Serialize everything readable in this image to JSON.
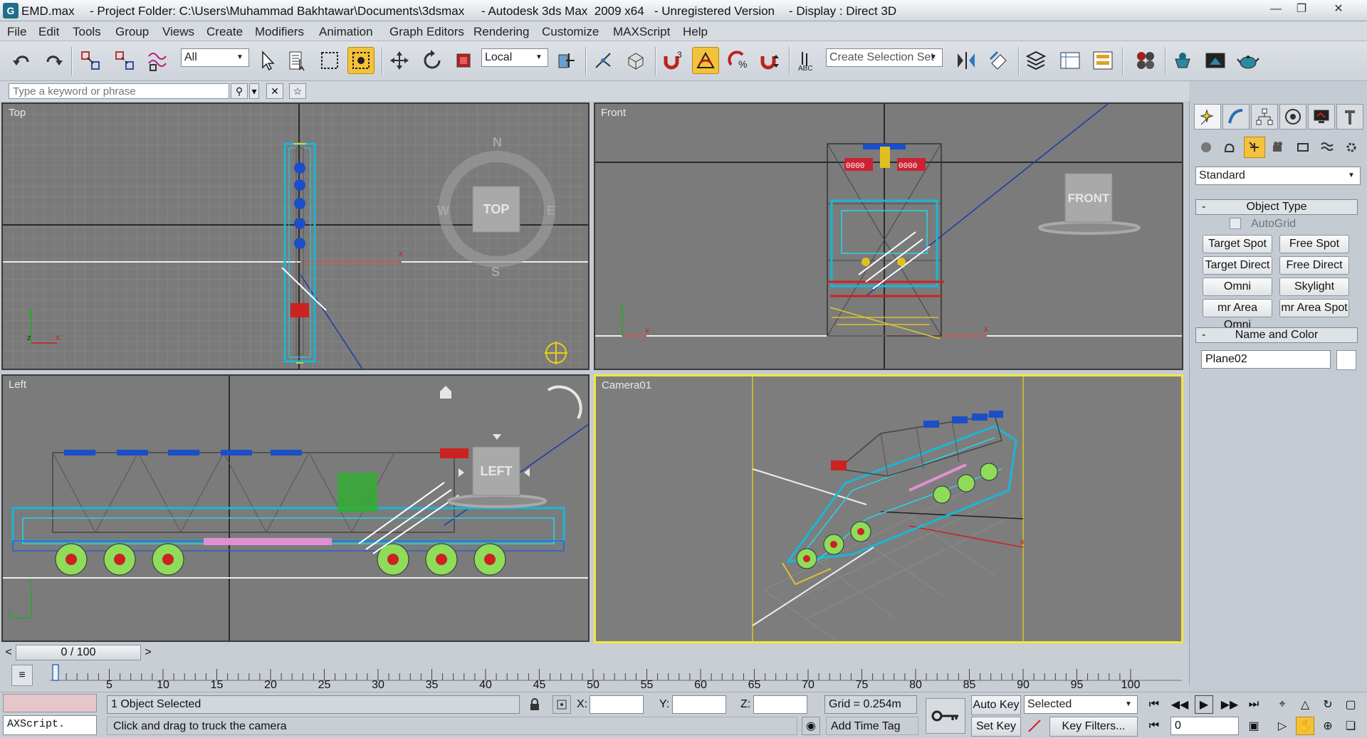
{
  "window": {
    "file": "EMD.max",
    "project": "- Project Folder: C:\\Users\\Muhammad Bakhtawar\\Documents\\3dsmax",
    "product": "- Autodesk 3ds Max  2009 x64   - Unregistered Version",
    "display": "- Display : Direct 3D"
  },
  "menu": [
    "File",
    "Edit",
    "Tools",
    "Group",
    "Views",
    "Create",
    "Modifiers",
    "Animation",
    "Graph Editors",
    "Rendering",
    "Customize",
    "MAXScript",
    "Help"
  ],
  "toolbar": {
    "filter_value": "All",
    "refcoord_value": "Local",
    "selection_set_placeholder": "Create Selection Set",
    "snap_count": "3",
    "abc_label": "ABC"
  },
  "search": {
    "placeholder": "Type a keyword or phrase"
  },
  "viewports": {
    "top": {
      "label": "Top",
      "cube": "TOP",
      "compass": [
        "N",
        "E",
        "S",
        "W"
      ]
    },
    "front": {
      "label": "Front",
      "cube": "FRONT",
      "counters": [
        "0000",
        "0000"
      ]
    },
    "left": {
      "label": "Left",
      "cube": "LEFT"
    },
    "camera": {
      "label": "Camera01"
    }
  },
  "command_panel": {
    "dropdown_value": "Standard",
    "rollout_object_type": "Object Type",
    "autogrid": "AutoGrid",
    "buttons": [
      "Target Spot",
      "Free Spot",
      "Target Direct",
      "Free Direct",
      "Omni",
      "Skylight",
      "mr Area Omni",
      "mr Area Spot"
    ],
    "rollout_name_color": "Name and Color",
    "object_name": "Plane02",
    "minus": "-"
  },
  "timeline": {
    "frame_display": "0 / 100",
    "ticks": [
      "5",
      "10",
      "15",
      "20",
      "25",
      "30",
      "35",
      "40",
      "45",
      "50",
      "55",
      "60",
      "65",
      "70",
      "75",
      "80",
      "85",
      "90",
      "95",
      "100"
    ]
  },
  "status": {
    "maxscript_text": "AXScript.",
    "selection_text": "1 Object Selected",
    "prompt_text": "Click and drag to truck the camera",
    "x_label": "X:",
    "y_label": "Y:",
    "z_label": "Z:",
    "grid_text": "Grid = 0.254m",
    "add_time_tag": "Add Time Tag",
    "auto_key": "Auto Key",
    "set_key": "Set Key",
    "selected_value": "Selected",
    "key_filters": "Key Filters...",
    "frame_value": "0"
  },
  "colors": {
    "active_border": "#f5e63a",
    "highlight_button": "#f4c23a",
    "model_cyan": "#19b7d6"
  }
}
